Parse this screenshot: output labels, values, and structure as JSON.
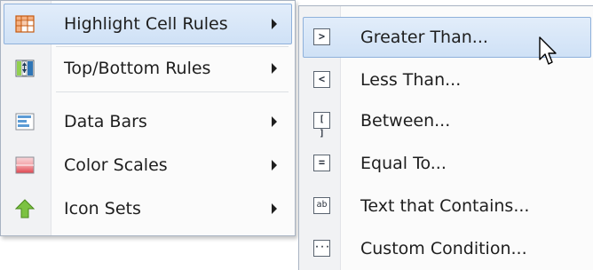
{
  "main_menu": {
    "items": [
      {
        "label": "Highlight Cell Rules",
        "icon": "highlight-cells-icon",
        "has_submenu": true,
        "active": true
      },
      {
        "label": "Top/Bottom Rules",
        "icon": "top-bottom-rules-icon",
        "has_submenu": true,
        "active": false
      },
      {
        "label": "Data Bars",
        "icon": "data-bars-icon",
        "has_submenu": true,
        "active": false
      },
      {
        "label": "Color Scales",
        "icon": "color-scales-icon",
        "has_submenu": true,
        "active": false
      },
      {
        "label": "Icon Sets",
        "icon": "icon-sets-icon",
        "has_submenu": true,
        "active": false
      }
    ]
  },
  "submenu": {
    "items": [
      {
        "label": "Greater Than...",
        "icon": "greater-than-icon",
        "glyph": ">",
        "active": true
      },
      {
        "label": "Less Than...",
        "icon": "less-than-icon",
        "glyph": "<",
        "active": false
      },
      {
        "label": "Between...",
        "icon": "between-icon",
        "glyph": "[ ]",
        "active": false
      },
      {
        "label": "Equal To...",
        "icon": "equal-to-icon",
        "glyph": "=",
        "active": false
      },
      {
        "label": "Text that Contains...",
        "icon": "text-contains-icon",
        "glyph": "ab",
        "active": false
      },
      {
        "label": "Custom Condition...",
        "icon": "custom-condition-icon",
        "glyph": "···",
        "active": false
      }
    ]
  },
  "colors": {
    "highlight_bg": "#d9e7f8",
    "highlight_border": "#8fb1db",
    "menu_border": "#a8b3c2",
    "text": "#1e1e1e"
  }
}
